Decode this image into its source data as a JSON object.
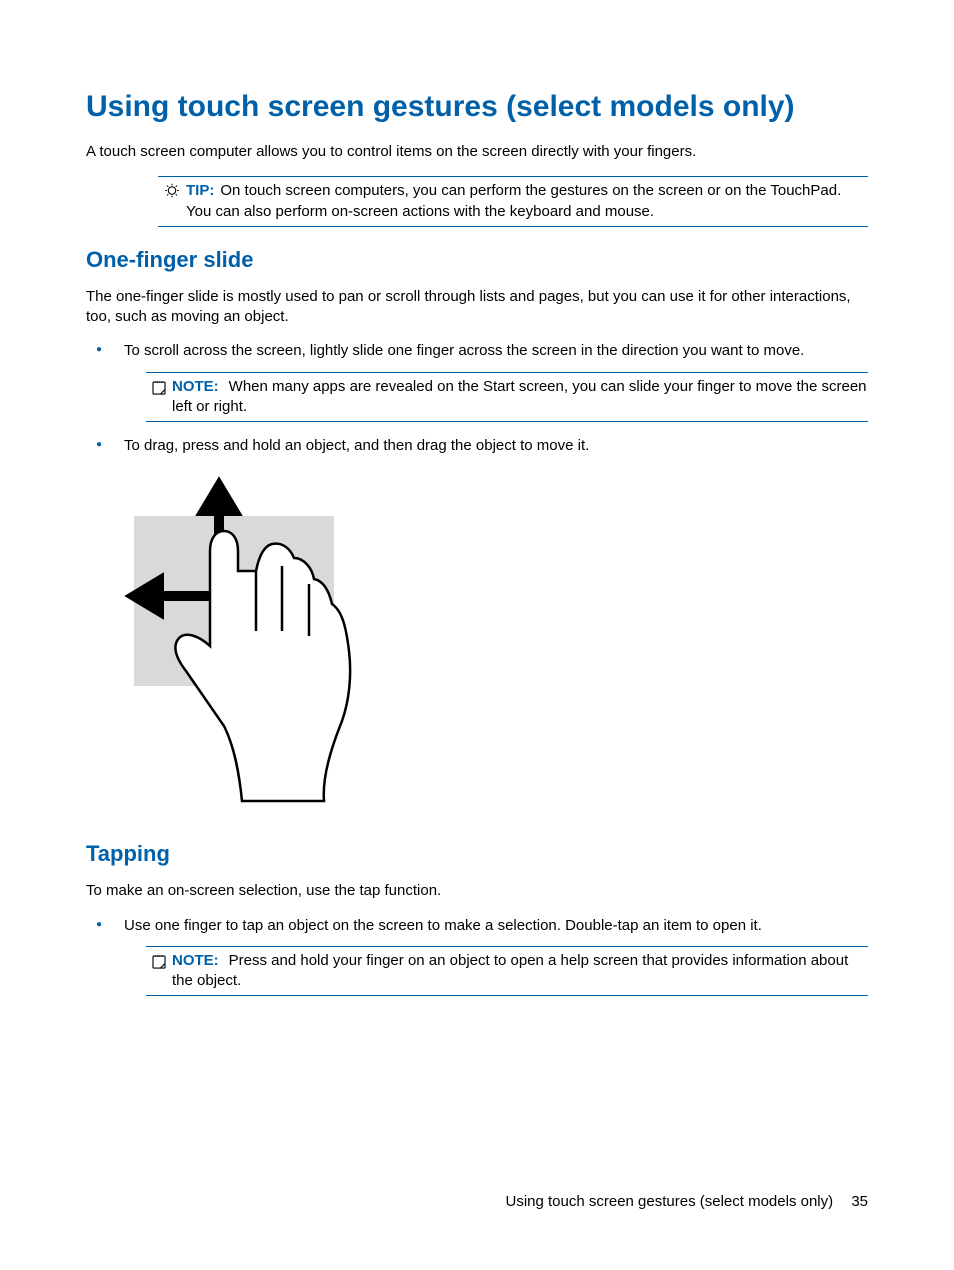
{
  "main_heading": "Using touch screen gestures (select models only)",
  "intro_text": "A touch screen computer allows you to control items on the screen directly with your fingers.",
  "tip": {
    "label": "TIP:",
    "text": "On touch screen computers, you can perform the gestures on the screen or on the TouchPad. You can also perform on-screen actions with the keyboard and mouse."
  },
  "sections": {
    "one_finger": {
      "heading": "One-finger slide",
      "intro": "The one-finger slide is mostly used to pan or scroll through lists and pages, but you can use it for other interactions, too, such as moving an object.",
      "bullet1": "To scroll across the screen, lightly slide one finger across the screen in the direction you want to move.",
      "note1": {
        "label": "NOTE:",
        "text": "When many apps are revealed on the Start screen, you can slide your finger to move the screen left or right."
      },
      "bullet2": "To drag, press and hold an object, and then drag the object to move it."
    },
    "tapping": {
      "heading": "Tapping",
      "intro": "To make an on-screen selection, use the tap function.",
      "bullet1": "Use one finger to tap an object on the screen to make a selection. Double-tap an item to open it.",
      "note1": {
        "label": "NOTE:",
        "text": "Press and hold your finger on an object to open a help screen that provides information about the object."
      }
    }
  },
  "footer": {
    "text": "Using touch screen gestures (select models only)",
    "page": "35"
  }
}
